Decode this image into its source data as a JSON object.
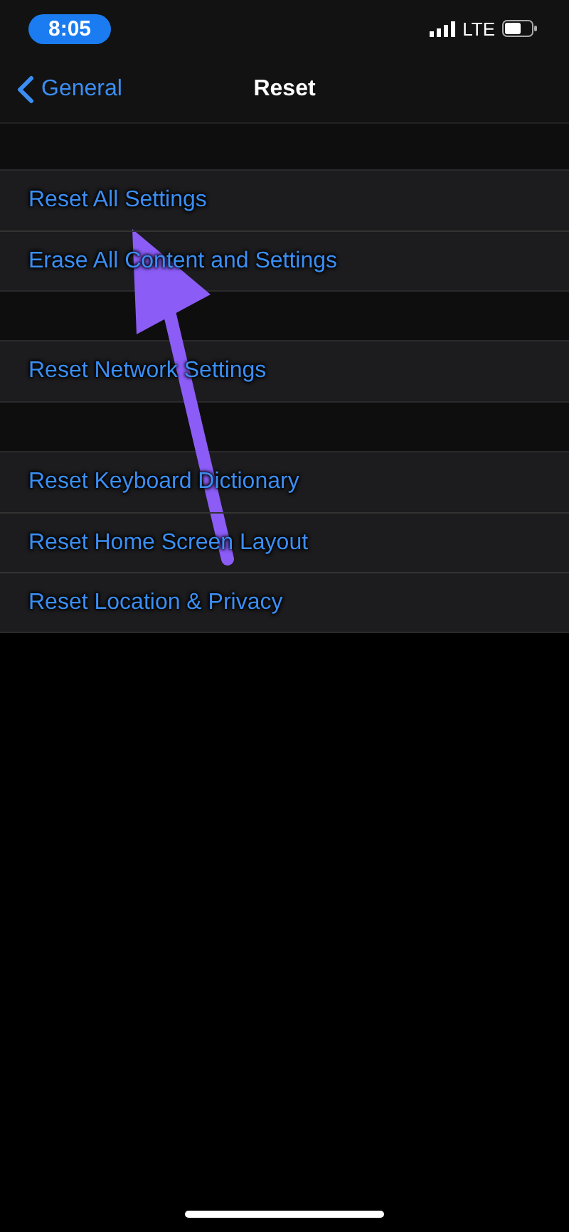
{
  "status_bar": {
    "time": "8:05",
    "network": "LTE"
  },
  "nav": {
    "back_label": "General",
    "title": "Reset"
  },
  "groups": [
    {
      "rows": [
        {
          "label": "Reset All Settings"
        },
        {
          "label": "Erase All Content and Settings"
        }
      ]
    },
    {
      "rows": [
        {
          "label": "Reset Network Settings"
        }
      ]
    },
    {
      "rows": [
        {
          "label": "Reset Keyboard Dictionary"
        },
        {
          "label": "Reset Home Screen Layout"
        },
        {
          "label": "Reset Location & Privacy"
        }
      ]
    }
  ]
}
